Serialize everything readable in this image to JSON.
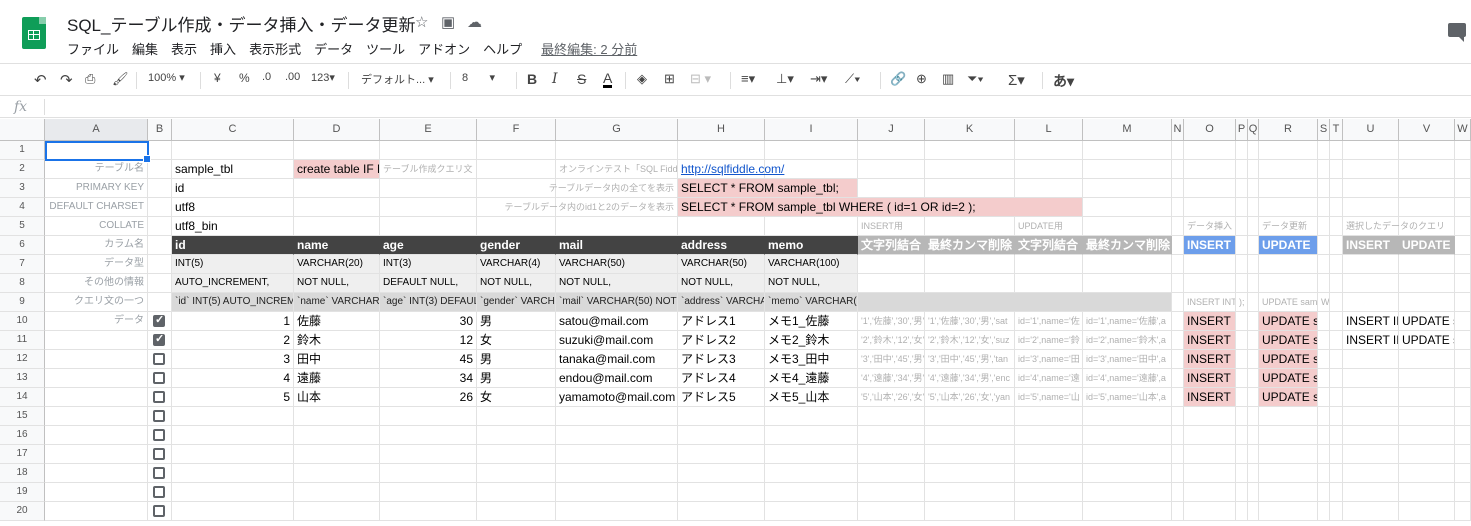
{
  "title": "SQL_テーブル作成・データ挿入・データ更新",
  "menu": [
    "ファイル",
    "編集",
    "表示",
    "挿入",
    "表示形式",
    "データ",
    "ツール",
    "アドオン",
    "ヘルプ"
  ],
  "last_edit": "最終編集: 2 分前",
  "toolbar": {
    "zoom": "100%",
    "currency": "¥",
    "percent": "%",
    "dec_less": ".0",
    "dec_more": ".00",
    "format_more": "123",
    "font": "デフォルト...",
    "font_size": "8"
  },
  "formula_bar": {
    "fx": "fx",
    "value": ""
  },
  "columns": [
    "A",
    "B",
    "C",
    "D",
    "E",
    "F",
    "G",
    "H",
    "I",
    "J",
    "K",
    "L",
    "M",
    "N",
    "O",
    "P",
    "Q",
    "R",
    "S",
    "T",
    "U",
    "V",
    "W"
  ],
  "rows": [
    "1",
    "2",
    "3",
    "4",
    "5",
    "6",
    "7",
    "8",
    "9",
    "10",
    "11",
    "12",
    "13",
    "14",
    "15",
    "16",
    "17",
    "18",
    "19",
    "20"
  ],
  "sheet": {
    "r2": {
      "a": "テーブル名",
      "c": "sample_tbl",
      "d": "create table IF NOT",
      "e": "テーブル作成クエリ文",
      "g": "オンラインテスト「SQL Fiddle」",
      "h": "http://sqlfiddle.com/"
    },
    "r3": {
      "a": "PRIMARY KEY",
      "c": "id",
      "g": "テーブルデータ内の全てを表示",
      "h": "SELECT * FROM sample_tbl;"
    },
    "r4": {
      "a": "DEFAULT CHARSET",
      "c": "utf8",
      "g": "テーブルデータ内のid1と2のデータを表示",
      "h": "SELECT * FROM sample_tbl WHERE ( id=1 OR id=2 );"
    },
    "r5": {
      "a": "COLLATE",
      "c": "utf8_bin",
      "j": "INSERT用",
      "l": "UPDATE用",
      "o": "データ挿入",
      "r": "データ更新",
      "u": "選択したデータのクエリ"
    },
    "r6": {
      "a": "カラム名",
      "c": "id",
      "d": "name",
      "e": "age",
      "f": "gender",
      "g": "mail",
      "h": "address",
      "i": "memo",
      "j": "文字列結合",
      "k": "最終カンマ削除",
      "l": "文字列結合",
      "m": "最終カンマ削除",
      "o": "INSERT",
      "r": "UPDATE",
      "u": "INSERT",
      "v": "UPDATE"
    },
    "r7": {
      "a": "データ型",
      "c": "INT(5)",
      "d": "VARCHAR(20)",
      "e": "INT(3)",
      "f": "VARCHAR(4)",
      "g": "VARCHAR(50)",
      "h": "VARCHAR(50)",
      "i": "VARCHAR(100)"
    },
    "r8": {
      "a": "その他の情報",
      "c": "AUTO_INCREMENT,",
      "d": "NOT NULL,",
      "e": "DEFAULT NULL,",
      "f": "NOT NULL,",
      "g": "NOT NULL,",
      "h": "NOT NULL,",
      "i": "NOT NULL,"
    },
    "r9": {
      "a": "クエリ文の一つ",
      "c": "`id` INT(5) AUTO_INCREMENT,",
      "d": "`name` VARCHAR(20)",
      "e": "`age` INT(3) DEFAULT",
      "f": "`gender` VARCHAR",
      "g": "`mail` VARCHAR(50) NOT N",
      "h": "`address` VARCHAR",
      "i": "`memo` VARCHAR(1",
      "o": "INSERT INT",
      "p": ");",
      "r": "UPDATE sam",
      "s": "W"
    },
    "data_label": "データ",
    "records": [
      {
        "checked": true,
        "id": "1",
        "name": "佐藤",
        "age": "30",
        "gender": "男",
        "mail": "satou@mail.com",
        "address": "アドレス1",
        "memo": "メモ1_佐藤",
        "j": "'1','佐藤','30','男',",
        "k": "'1','佐藤','30','男','sat",
        "l": "id='1',name='佐",
        "m": "id='1',name='佐藤',a",
        "o": "INSERT I",
        "r": "UPDATE s",
        "u": "INSERT II",
        "v": "UPDATE s"
      },
      {
        "checked": true,
        "id": "2",
        "name": "鈴木",
        "age": "12",
        "gender": "女",
        "mail": "suzuki@mail.com",
        "address": "アドレス2",
        "memo": "メモ2_鈴木",
        "j": "'2','鈴木','12','女'",
        "k": "'2','鈴木','12','女','suz",
        "l": "id='2',name='鈴",
        "m": "id='2',name='鈴木',a",
        "o": "INSERT I",
        "r": "UPDATE s",
        "u": "INSERT II",
        "v": "UPDATE s"
      },
      {
        "checked": false,
        "id": "3",
        "name": "田中",
        "age": "45",
        "gender": "男",
        "mail": "tanaka@mail.com",
        "address": "アドレス3",
        "memo": "メモ3_田中",
        "j": "'3','田中','45','男',",
        "k": "'3','田中','45','男','tan",
        "l": "id='3',name='田",
        "m": "id='3',name='田中',a",
        "o": "INSERT I",
        "r": "UPDATE s",
        "u": "",
        "v": ""
      },
      {
        "checked": false,
        "id": "4",
        "name": "遠藤",
        "age": "34",
        "gender": "男",
        "mail": "endou@mail.com",
        "address": "アドレス4",
        "memo": "メモ4_遠藤",
        "j": "'4','遠藤','34','男',",
        "k": "'4','遠藤','34','男','enc",
        "l": "id='4',name='遠",
        "m": "id='4',name='遠藤',a",
        "o": "INSERT I",
        "r": "UPDATE s",
        "u": "",
        "v": ""
      },
      {
        "checked": false,
        "id": "5",
        "name": "山本",
        "age": "26",
        "gender": "女",
        "mail": "yamamoto@mail.com",
        "address": "アドレス5",
        "memo": "メモ5_山本",
        "j": "'5','山本','26','女',",
        "k": "'5','山本','26','女','yan",
        "l": "id='5',name='山",
        "m": "id='5',name='山本',a",
        "o": "INSERT I",
        "r": "UPDATE s",
        "u": "",
        "v": ""
      }
    ]
  },
  "colors": {
    "accent": "#1a73e8",
    "header_dark": "#434343",
    "header_grey": "#b7b7b7",
    "insert_blue": "#6d9eeb",
    "pink": "#f4cccc"
  }
}
